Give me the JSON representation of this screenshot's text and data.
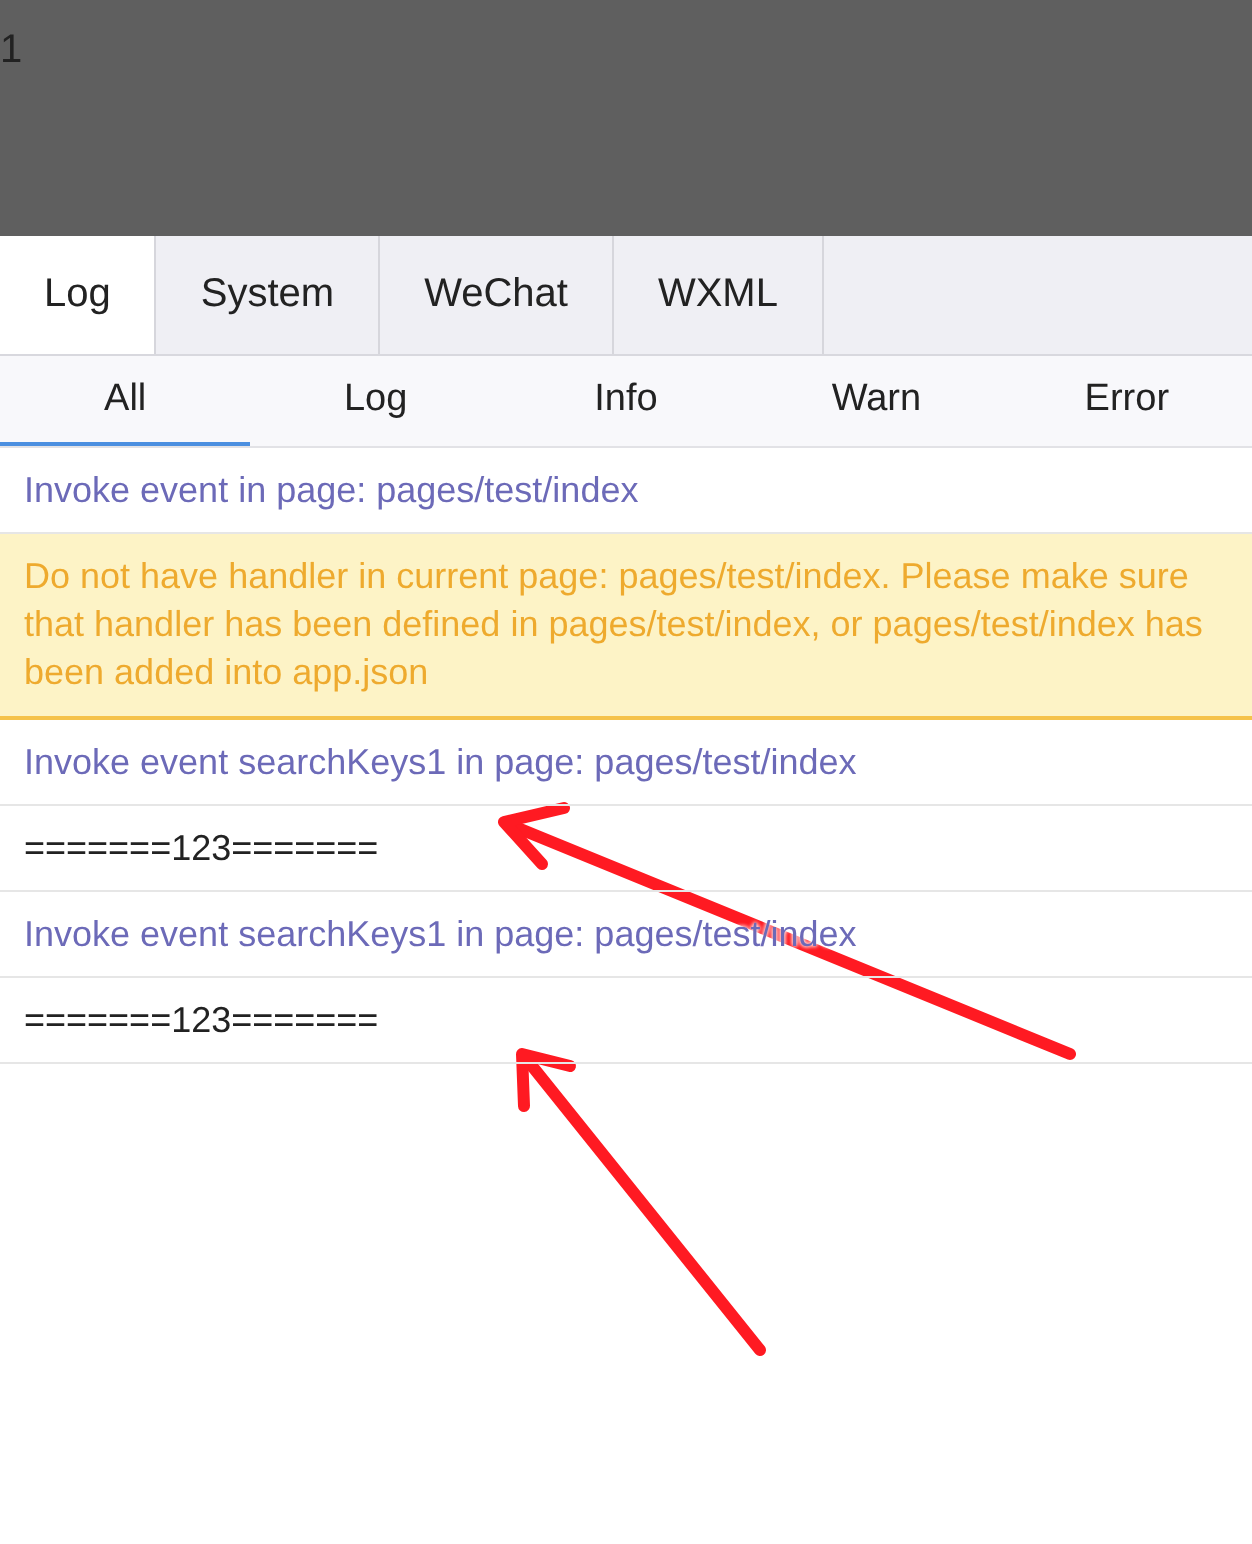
{
  "preview": {
    "text": "1"
  },
  "tabs": [
    {
      "label": "Log",
      "selected": true
    },
    {
      "label": "System",
      "selected": false
    },
    {
      "label": "WeChat",
      "selected": false
    },
    {
      "label": "WXML",
      "selected": false
    }
  ],
  "filters": [
    {
      "label": "All",
      "selected": true
    },
    {
      "label": "Log",
      "selected": false
    },
    {
      "label": "Info",
      "selected": false
    },
    {
      "label": "Warn",
      "selected": false
    },
    {
      "label": "Error",
      "selected": false
    }
  ],
  "entries": [
    {
      "kind": "info",
      "text": "Invoke event in page: pages/test/index"
    },
    {
      "kind": "warn",
      "text": "Do not have handler in current page: pages/test/index. Please make sure that handler has been defined in pages/test/index, or pages/test/index has been added into app.json"
    },
    {
      "kind": "info",
      "text": "Invoke event searchKeys1 in page: pages/test/index"
    },
    {
      "kind": "log",
      "text": "=======123======="
    },
    {
      "kind": "info",
      "text": "Invoke event searchKeys1 in page: pages/test/index"
    },
    {
      "kind": "log",
      "text": "=======123======="
    }
  ]
}
